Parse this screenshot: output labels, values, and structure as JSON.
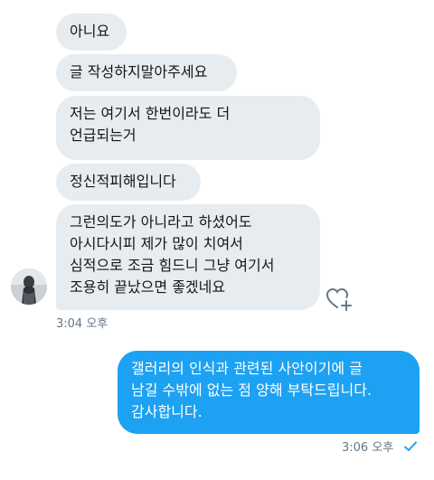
{
  "conversation": {
    "received": [
      {
        "lines": [
          "아니요"
        ]
      },
      {
        "lines": [
          "글 작성하지말아주세요"
        ]
      },
      {
        "lines": [
          "저는 여기서 한번이라도 더",
          "언급되는거"
        ]
      },
      {
        "lines": [
          "정신적피해입니다"
        ]
      },
      {
        "lines": [
          "그런의도가 아니라고 하셨어도",
          "아시다시피 제가 많이 치여서",
          "심적으로 조금 힘드니 그냥 여기서",
          "조용히 끝났으면 좋겠네요"
        ]
      }
    ],
    "received_time": "3:04 오후",
    "sent": [
      {
        "lines": [
          "갤러리의 인식과 관련된 사안이기에 글",
          "남길 수밖에 없는 점 양해 부탁드립니다.",
          "감사합니다."
        ]
      }
    ],
    "sent_time": "3:06 오후",
    "sent_status": "read-checkmark-icon"
  },
  "colors": {
    "received_bubble": "#e6ecf0",
    "sent_bubble": "#1da1f2",
    "timestamp": "#657786"
  },
  "icons": {
    "like": "heart-plus-icon",
    "status": "checkmark-icon"
  }
}
